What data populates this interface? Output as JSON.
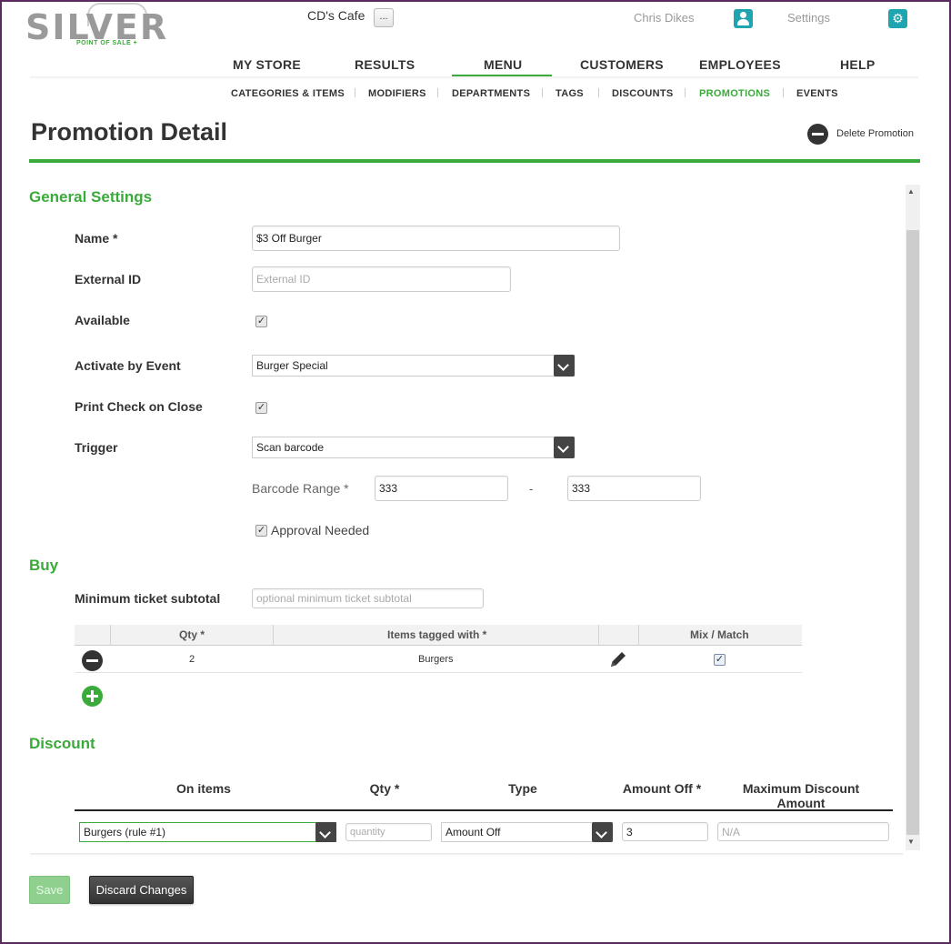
{
  "header": {
    "logo_text": "SILVER",
    "logo_sub": "POINT OF SALE +",
    "store_name": "CD's Cafe",
    "store_button": "...",
    "user_name": "Chris Dikes",
    "settings_label": "Settings",
    "accent_color": "#3aaa3a",
    "icon_color": "#1fa5b0"
  },
  "main_nav": {
    "items": [
      "MY STORE",
      "RESULTS",
      "MENU",
      "CUSTOMERS",
      "EMPLOYEES",
      "HELP"
    ],
    "active": "MENU"
  },
  "sub_nav": {
    "items": [
      "CATEGORIES & ITEMS",
      "MODIFIERS",
      "DEPARTMENTS",
      "TAGS",
      "DISCOUNTS",
      "PROMOTIONS",
      "EVENTS"
    ],
    "active": "PROMOTIONS"
  },
  "page": {
    "title": "Promotion Detail",
    "delete_label": "Delete Promotion"
  },
  "general": {
    "section_title": "General Settings",
    "name_label": "Name *",
    "name_value": "$3 Off Burger",
    "external_id_label": "External ID",
    "external_id_placeholder": "External ID",
    "available_label": "Available",
    "available_checked": true,
    "activate_label": "Activate by Event",
    "activate_value": "Burger Special",
    "print_label": "Print Check on Close",
    "print_checked": true,
    "trigger_label": "Trigger",
    "trigger_value": "Scan barcode",
    "barcode_label": "Barcode Range *",
    "barcode_from": "333",
    "barcode_dash": "-",
    "barcode_to": "333",
    "approval_label": "Approval Needed",
    "approval_checked": true
  },
  "buy": {
    "section_title": "Buy",
    "min_subtotal_label": "Minimum ticket subtotal",
    "min_subtotal_placeholder": "optional minimum ticket subtotal",
    "columns": [
      "Qty *",
      "Items tagged with *",
      "Mix / Match"
    ],
    "rows": [
      {
        "qty": "2",
        "tag": "Burgers",
        "mix_match": true
      }
    ]
  },
  "discount": {
    "section_title": "Discount",
    "columns": {
      "on_items": "On items",
      "qty": "Qty *",
      "type": "Type",
      "amount_off": "Amount Off *",
      "max_discount": "Maximum Discount Amount"
    },
    "row": {
      "on_items": "Burgers (rule #1)",
      "qty_placeholder": "quantity",
      "type": "Amount Off",
      "amount_off": "3",
      "max_placeholder": "N/A"
    }
  },
  "actions": {
    "save": "Save",
    "discard": "Discard Changes"
  }
}
